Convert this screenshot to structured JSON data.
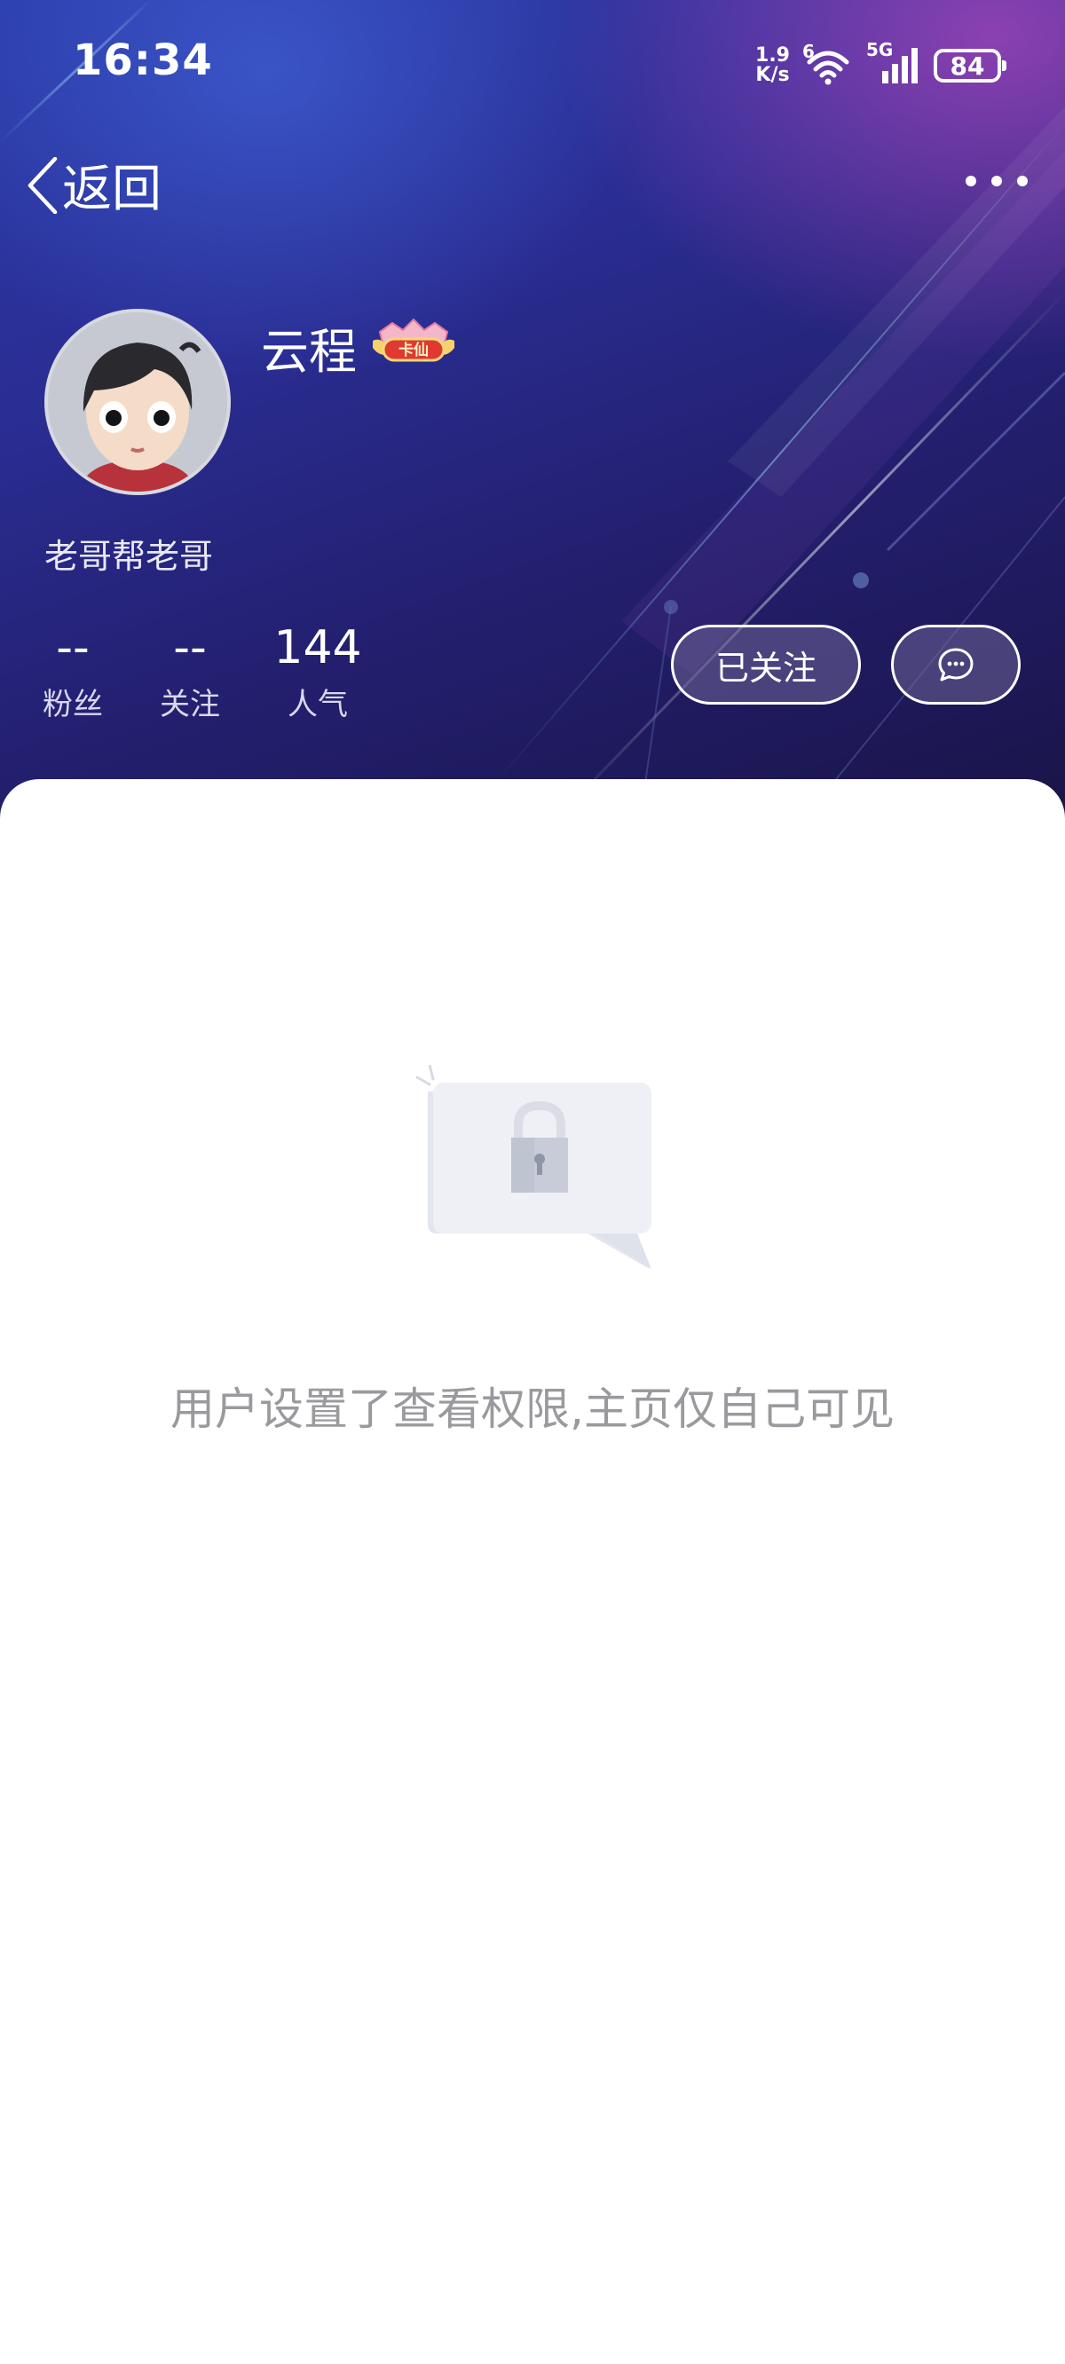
{
  "status_bar": {
    "time": "16:34",
    "net_speed_value": "1.9",
    "net_speed_unit": "K/s",
    "wifi_label": "6",
    "cell_label": "5G",
    "battery": "84"
  },
  "nav": {
    "back_label": "返回"
  },
  "profile": {
    "name": "云程",
    "badge_text": "卡仙",
    "signature": "老哥帮老哥"
  },
  "stats": [
    {
      "value": "--",
      "label": "粉丝"
    },
    {
      "value": "--",
      "label": "关注"
    },
    {
      "value": "144",
      "label": "人气"
    }
  ],
  "actions": {
    "followed_label": "已关注",
    "message_icon": "chat-bubble-icon"
  },
  "content": {
    "privacy_message": "用户设置了查看权限,主页仅自己可见",
    "illustration_icon": "lock-icon"
  },
  "colors": {
    "hero_dark": "#231f6e",
    "hero_accent_pink": "#dc50c8",
    "text_muted": "#9a9a9e"
  }
}
